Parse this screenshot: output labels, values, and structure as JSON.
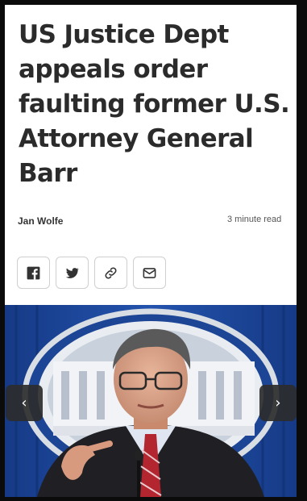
{
  "article": {
    "headline": "US Justice Dept appeals order faulting former U.S. Attorney General Barr",
    "author": "Jan Wolfe",
    "read_time": "3 minute read"
  },
  "share": {
    "icons": [
      "facebook-icon",
      "twitter-icon",
      "link-icon",
      "email-icon"
    ]
  },
  "gallery": {
    "prev_glyph": "‹",
    "next_glyph": "›"
  },
  "colors": {
    "headline": "#2b2b2b",
    "background": "#ffffff",
    "photo_backdrop": "#1a3f86"
  }
}
